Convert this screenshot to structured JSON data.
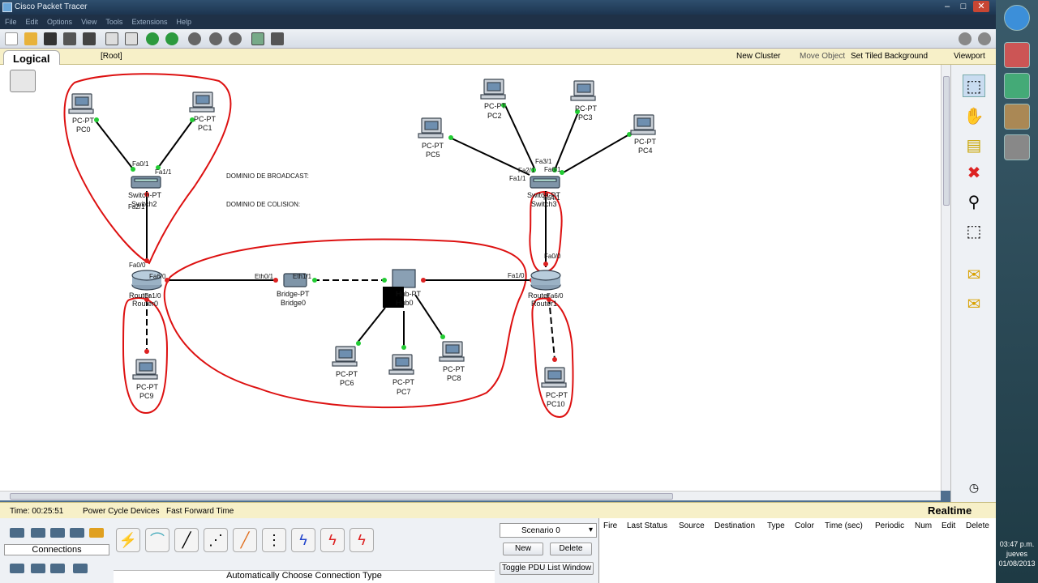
{
  "window": {
    "title": "Cisco Packet Tracer",
    "min": "–",
    "max": "□",
    "close": "✕"
  },
  "menu": [
    "File",
    "Edit",
    "Options",
    "View",
    "Tools",
    "Extensions",
    "Help"
  ],
  "navbar": {
    "tab": "Logical",
    "root": "[Root]",
    "new_cluster": "New Cluster",
    "move_object": "Move Object",
    "set_tiled": "Set Tiled Background",
    "viewport": "Viewport"
  },
  "workspace": {
    "text_broadcast": "DOMINIO DE BROADCAST:",
    "text_collision": "DOMINIO DE COLISION:",
    "devices": {
      "pc0": {
        "type": "PC-PT",
        "name": "PC0"
      },
      "pc1": {
        "type": "PC-PT",
        "name": "PC1"
      },
      "pc2": {
        "type": "PC-PT",
        "name": "PC2"
      },
      "pc3": {
        "type": "PC-PT",
        "name": "PC3"
      },
      "pc4": {
        "type": "PC-PT",
        "name": "PC4"
      },
      "pc5": {
        "type": "PC-PT",
        "name": "PC5"
      },
      "pc6": {
        "type": "PC-PT",
        "name": "PC6"
      },
      "pc7": {
        "type": "PC-PT",
        "name": "PC7"
      },
      "pc8": {
        "type": "PC-PT",
        "name": "PC8"
      },
      "pc9": {
        "type": "PC-PT",
        "name": "PC9"
      },
      "pc10": {
        "type": "PC-PT",
        "name": "PC10"
      },
      "switch2": {
        "type": "Switch-PT",
        "name": "Switch2"
      },
      "switch3": {
        "type": "Switch-PT",
        "name": "Switch3"
      },
      "router0": {
        "type": "Router",
        "name": "Router0"
      },
      "router1": {
        "type": "Router",
        "name": "Router1"
      },
      "bridge0": {
        "type": "Bridge-PT",
        "name": "Bridge0"
      },
      "hub0": {
        "type": "Hub-PT",
        "name": "Hub0"
      }
    },
    "ports": {
      "fa0_1": "Fa0/1",
      "fa1_1": "Fa1/1",
      "fa2_1": "Fa2/1",
      "fa0_0": "Fa0/0",
      "fa6_0": "Fa6/0",
      "fa1_0": "Fa1/0",
      "eth0_1": "Eth0/1",
      "eth1_1": "Eth1/1",
      "fa3_1": "Fa3/1",
      "fa6_1": "Fa6/1",
      "fa4_1": "Fa4/1"
    }
  },
  "status": {
    "time": "Time: 00:25:51",
    "power": "Power Cycle Devices",
    "ffwd": "Fast Forward Time",
    "mode": "Realtime"
  },
  "bottom": {
    "connections": "Connections",
    "auto_type": "Automatically Choose Connection Type",
    "scenario": "Scenario 0",
    "new": "New",
    "delete": "Delete",
    "toggle_pdu": "Toggle PDU List Window",
    "pdu_cols": [
      "Fire",
      "Last Status",
      "Source",
      "Destination",
      "Type",
      "Color",
      "Time (sec)",
      "Periodic",
      "Num",
      "Edit",
      "Delete"
    ]
  },
  "clock": {
    "time": "03:47 p.m.",
    "day": "jueves",
    "date": "01/08/2013"
  },
  "colors": {
    "link_up": "#22cc33",
    "link_down": "#dd2222",
    "annotation": "#dd1111"
  }
}
